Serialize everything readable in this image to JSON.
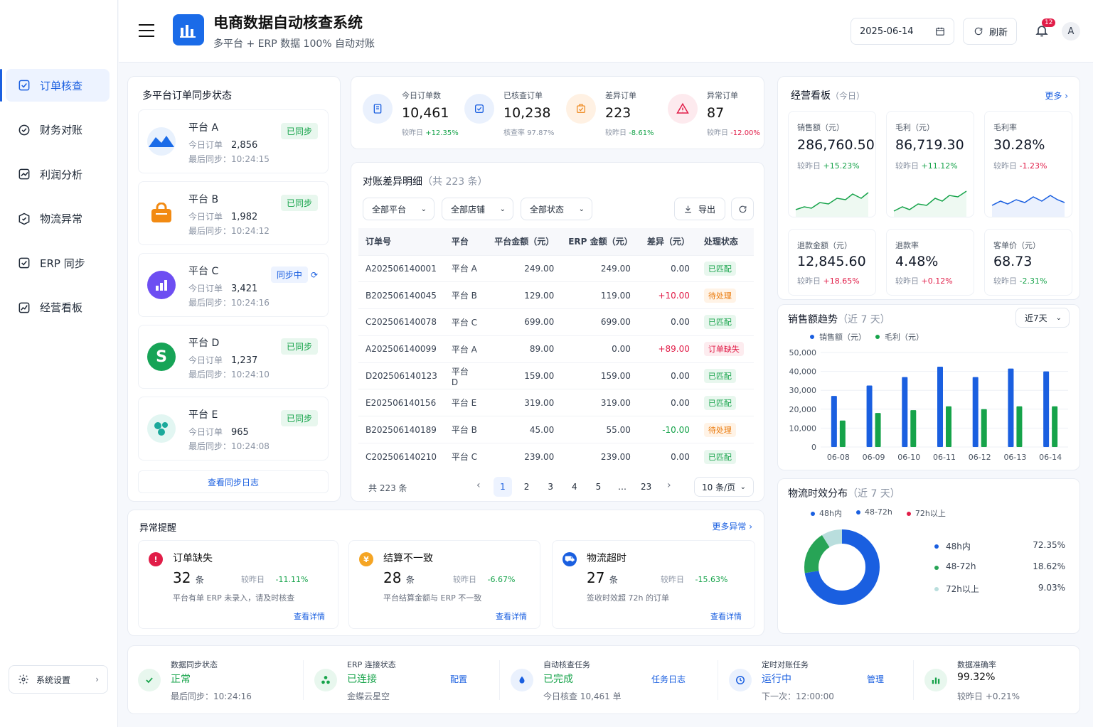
{
  "app": {
    "title": "电商数据自动核查系统",
    "subtitle": "多平台 + ERP 数据 100% 自动对账"
  },
  "header": {
    "date": "2025-06-14",
    "refresh": "刷新",
    "notif_count": "12",
    "avatar": "A"
  },
  "sidebar": {
    "items": [
      {
        "label": "订单核查",
        "icon": "order-check-icon"
      },
      {
        "label": "财务对账",
        "icon": "finance-icon"
      },
      {
        "label": "利润分析",
        "icon": "profit-icon"
      },
      {
        "label": "物流异常",
        "icon": "logistics-icon"
      },
      {
        "label": "ERP 同步",
        "icon": "erp-sync-icon"
      },
      {
        "label": "经营看板",
        "icon": "dashboard-icon"
      }
    ],
    "settings": "系统设置"
  },
  "sync": {
    "title": "多平台订单同步状态",
    "today_label": "今日订单",
    "last_label": "最后同步：",
    "platforms": [
      {
        "name": "平台 A",
        "orders": "2,856",
        "time": "10:24:15",
        "status": "已同步"
      },
      {
        "name": "平台 B",
        "orders": "1,982",
        "time": "10:24:12",
        "status": "已同步"
      },
      {
        "name": "平台 C",
        "orders": "3,421",
        "time": "10:24:16",
        "status": "同步中"
      },
      {
        "name": "平台 D",
        "orders": "1,237",
        "time": "10:24:10",
        "status": "已同步"
      },
      {
        "name": "平台 E",
        "orders": "965",
        "time": "10:24:08",
        "status": "已同步"
      }
    ],
    "log_link": "查看同步日志"
  },
  "kpis": [
    {
      "label": "今日订单数",
      "value": "10,461",
      "cmp": "较昨日",
      "delta": "+12.35%",
      "color": "#1a5fe0"
    },
    {
      "label": "已核查订单",
      "value": "10,238",
      "cmp": "核查率",
      "delta": "97.87%",
      "color": "#1a5fe0"
    },
    {
      "label": "差异订单",
      "value": "223",
      "cmp": "较昨日",
      "delta": "-8.61%",
      "color": "#ef8f2a"
    },
    {
      "label": "异常订单",
      "value": "87",
      "cmp": "较昨日",
      "delta": "-12.00%",
      "color": "#e11d48"
    }
  ],
  "diff": {
    "title": "对账差异明细",
    "count": "（共 223 条）",
    "filters": [
      "全部平台",
      "全部店铺",
      "全部状态"
    ],
    "export": "导出",
    "columns": [
      "订单号",
      "平台",
      "平台金额（元）",
      "ERP 金额（元）",
      "差异（元）",
      "处理状态"
    ],
    "rows": [
      {
        "id": "A202506140001",
        "platform": "平台 A",
        "pa": "249.00",
        "erp": "249.00",
        "diff": "0.00",
        "status": "已匹配",
        "st": "ok",
        "dc": ""
      },
      {
        "id": "B202506140045",
        "platform": "平台 B",
        "pa": "129.00",
        "erp": "119.00",
        "diff": "+10.00",
        "status": "待处理",
        "st": "pend",
        "dc": "red"
      },
      {
        "id": "C202506140078",
        "platform": "平台 C",
        "pa": "699.00",
        "erp": "699.00",
        "diff": "0.00",
        "status": "已匹配",
        "st": "ok",
        "dc": ""
      },
      {
        "id": "A202506140099",
        "platform": "平台 A",
        "pa": "89.00",
        "erp": "0.00",
        "diff": "+89.00",
        "status": "订单缺失",
        "st": "miss",
        "dc": "red"
      },
      {
        "id": "D202506140123",
        "platform": "平台 D",
        "pa": "159.00",
        "erp": "159.00",
        "diff": "0.00",
        "status": "已匹配",
        "st": "ok",
        "dc": ""
      },
      {
        "id": "E202506140156",
        "platform": "平台 E",
        "pa": "319.00",
        "erp": "319.00",
        "diff": "0.00",
        "status": "已匹配",
        "st": "ok",
        "dc": ""
      },
      {
        "id": "B202506140189",
        "platform": "平台 B",
        "pa": "45.00",
        "erp": "55.00",
        "diff": "-10.00",
        "status": "待处理",
        "st": "pend",
        "dc": "green"
      },
      {
        "id": "C202506140210",
        "platform": "平台 C",
        "pa": "239.00",
        "erp": "239.00",
        "diff": "0.00",
        "status": "已匹配",
        "st": "ok",
        "dc": ""
      }
    ],
    "total": "共 223 条",
    "pages": [
      "1",
      "2",
      "3",
      "4",
      "5",
      "…",
      "23"
    ],
    "page_size": "10 条/页"
  },
  "board": {
    "title": "经营看板",
    "sub": "（今日）",
    "more": "更多",
    "cards": [
      {
        "label": "销售额（元）",
        "value": "286,760.50",
        "cmp": "较昨日",
        "delta": "+15.23%",
        "dc": "green"
      },
      {
        "label": "毛利（元）",
        "value": "86,719.30",
        "cmp": "较昨日",
        "delta": "+11.12%",
        "dc": "green"
      },
      {
        "label": "毛利率",
        "value": "30.28%",
        "cmp": "较昨日",
        "delta": "-1.23%",
        "dc": "red"
      },
      {
        "label": "退款金额（元）",
        "value": "12,845.60",
        "cmp": "较昨日",
        "delta": "+18.65%",
        "dc": "red"
      },
      {
        "label": "退款率",
        "value": "4.48%",
        "cmp": "较昨日",
        "delta": "+0.12%",
        "dc": "red"
      },
      {
        "label": "客单价（元）",
        "value": "68.73",
        "cmp": "较昨日",
        "delta": "-2.31%",
        "dc": "green"
      }
    ]
  },
  "chart_data": [
    {
      "type": "bar",
      "title": "销售额趋势",
      "subtitle": "（近 7 天）",
      "range_select": "近7天",
      "categories": [
        "06-08",
        "06-09",
        "06-10",
        "06-11",
        "06-12",
        "06-13",
        "06-14"
      ],
      "series": [
        {
          "name": "销售额（元）",
          "color": "#1a5fe0",
          "values": [
            27000,
            32500,
            37000,
            42500,
            37000,
            41500,
            40000
          ]
        },
        {
          "name": "毛利（元）",
          "color": "#16a34a",
          "values": [
            14000,
            18000,
            19500,
            21500,
            20000,
            21500,
            21500
          ]
        }
      ],
      "yticks": [
        "50,000",
        "40,000",
        "30,000",
        "20,000",
        "10,000",
        "0"
      ],
      "ylim": [
        0,
        50000
      ],
      "legend": "top-left",
      "grid": true
    },
    {
      "type": "pie",
      "title": "物流时效分布",
      "subtitle": "（近 7 天）",
      "slices": [
        {
          "name": "48h内",
          "value": 72.35,
          "label": "72.35%",
          "color": "#1a5fe0"
        },
        {
          "name": "48-72h",
          "value": 18.62,
          "label": "18.62%",
          "color": "#27a456"
        },
        {
          "name": "72h以上",
          "value": 9.03,
          "label": "9.03%",
          "color": "#b9dedd"
        }
      ],
      "legend_top": [
        {
          "name": "48h内",
          "color": "#1a5fe0"
        },
        {
          "name": "48-72h",
          "color": "#1a5fe0"
        },
        {
          "name": "72h以上",
          "color": "#e11d48"
        }
      ]
    }
  ],
  "alerts": {
    "title": "异常提醒",
    "more": "更多异常",
    "items": [
      {
        "title": "订单缺失",
        "count": "32",
        "unit": "条",
        "cmp": "较昨日",
        "delta": "-11.11%",
        "desc": "平台有单 ERP 未录入，请及时核查",
        "link": "查看详情",
        "color": "#e11d48"
      },
      {
        "title": "结算不一致",
        "count": "28",
        "unit": "条",
        "cmp": "较昨日",
        "delta": "-6.67%",
        "desc": "平台结算金额与 ERP 不一致",
        "link": "查看详情",
        "color": "#f5a524"
      },
      {
        "title": "物流超时",
        "count": "27",
        "unit": "条",
        "cmp": "较昨日",
        "delta": "-15.63%",
        "desc": "签收时效超 72h 的订单",
        "link": "查看详情",
        "color": "#1a5fe0"
      }
    ]
  },
  "footer": [
    {
      "label": "数据同步状态",
      "value": "正常",
      "vc": "green",
      "sub": "最后同步：10:24:16",
      "action": ""
    },
    {
      "label": "ERP 连接状态",
      "value": "已连接",
      "vc": "green",
      "sub": "金蝶云星空",
      "action": "配置"
    },
    {
      "label": "自动核查任务",
      "value": "已完成",
      "vc": "green",
      "sub": "今日核查 10,461 单",
      "action": "任务日志"
    },
    {
      "label": "定时对账任务",
      "value": "运行中",
      "vc": "blue",
      "sub": "下一次：12:00:00",
      "action": "管理"
    },
    {
      "label": "数据准确率",
      "value": "99.32%",
      "vc": "dark",
      "sub": "较昨日 +0.21%",
      "action": ""
    }
  ]
}
